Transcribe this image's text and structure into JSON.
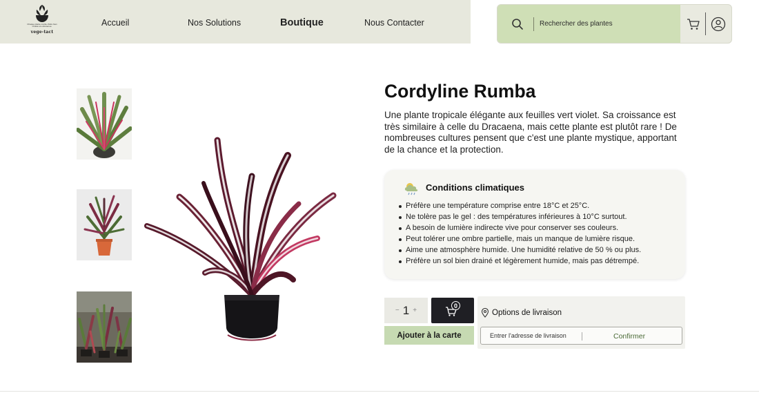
{
  "header": {
    "logo": {
      "name": "vege-tact",
      "tagline": "Chaque plante mérite d'être bien choisie et entretenue."
    },
    "nav": [
      {
        "label": "Accueil",
        "active": false
      },
      {
        "label": "Nos Solutions",
        "active": false
      },
      {
        "label": "Boutique",
        "active": true
      },
      {
        "label": "Nous Contacter",
        "active": false
      }
    ],
    "search": {
      "placeholder": "Rechercher des plantes"
    },
    "icons": [
      "search-icon",
      "cart-icon",
      "user-icon"
    ]
  },
  "gallery": {
    "thumbnails": [
      "cordyline-closeup",
      "cordyline-pot-orange",
      "cordyline-greenhouse"
    ],
    "main_image": "cordyline-rumba-black-pot"
  },
  "product": {
    "title": "Cordyline Rumba",
    "description": "Une plante tropicale élégante aux feuilles vert violet. Sa croissance est très similaire à celle du Dracaena, mais cette plante est plutôt rare ! De nombreuses cultures pensent que c'est une plante mystique, apportant de la chance et la protection.",
    "climate": {
      "title": "Conditions climatiques",
      "icon": "weather-cloud-rain-icon",
      "items": [
        "Préfère une température comprise entre 18°C et 25°C.",
        "Ne tolère pas le gel : des températures inférieures à 10°C surtout.",
        "A besoin de lumière indirecte vive pour conserver ses couleurs.",
        "Peut tolérer une ombre partielle, mais un manque de lumière risque.",
        "Aime une atmosphère humide. Une humidité relative de 50 % ou plus.",
        "Préfère un sol bien drainé et légèrement humide, mais pas détrempé."
      ]
    }
  },
  "purchase": {
    "quantity": "1",
    "minus": "−",
    "plus": "+",
    "cart_count": "0",
    "add_button": "Ajouter à la carte",
    "delivery": {
      "title": "Options de livraison",
      "placeholder": "Entrer l'adresse de livraison",
      "confirm": "Confirmer"
    }
  },
  "colors": {
    "nav_bg": "#e7e8dd",
    "search_bg": "#cfdfb6",
    "add_button_bg": "#c6dab2",
    "cart_button_bg": "#1f1f24",
    "plant_leaf": "#7a1f3a"
  }
}
